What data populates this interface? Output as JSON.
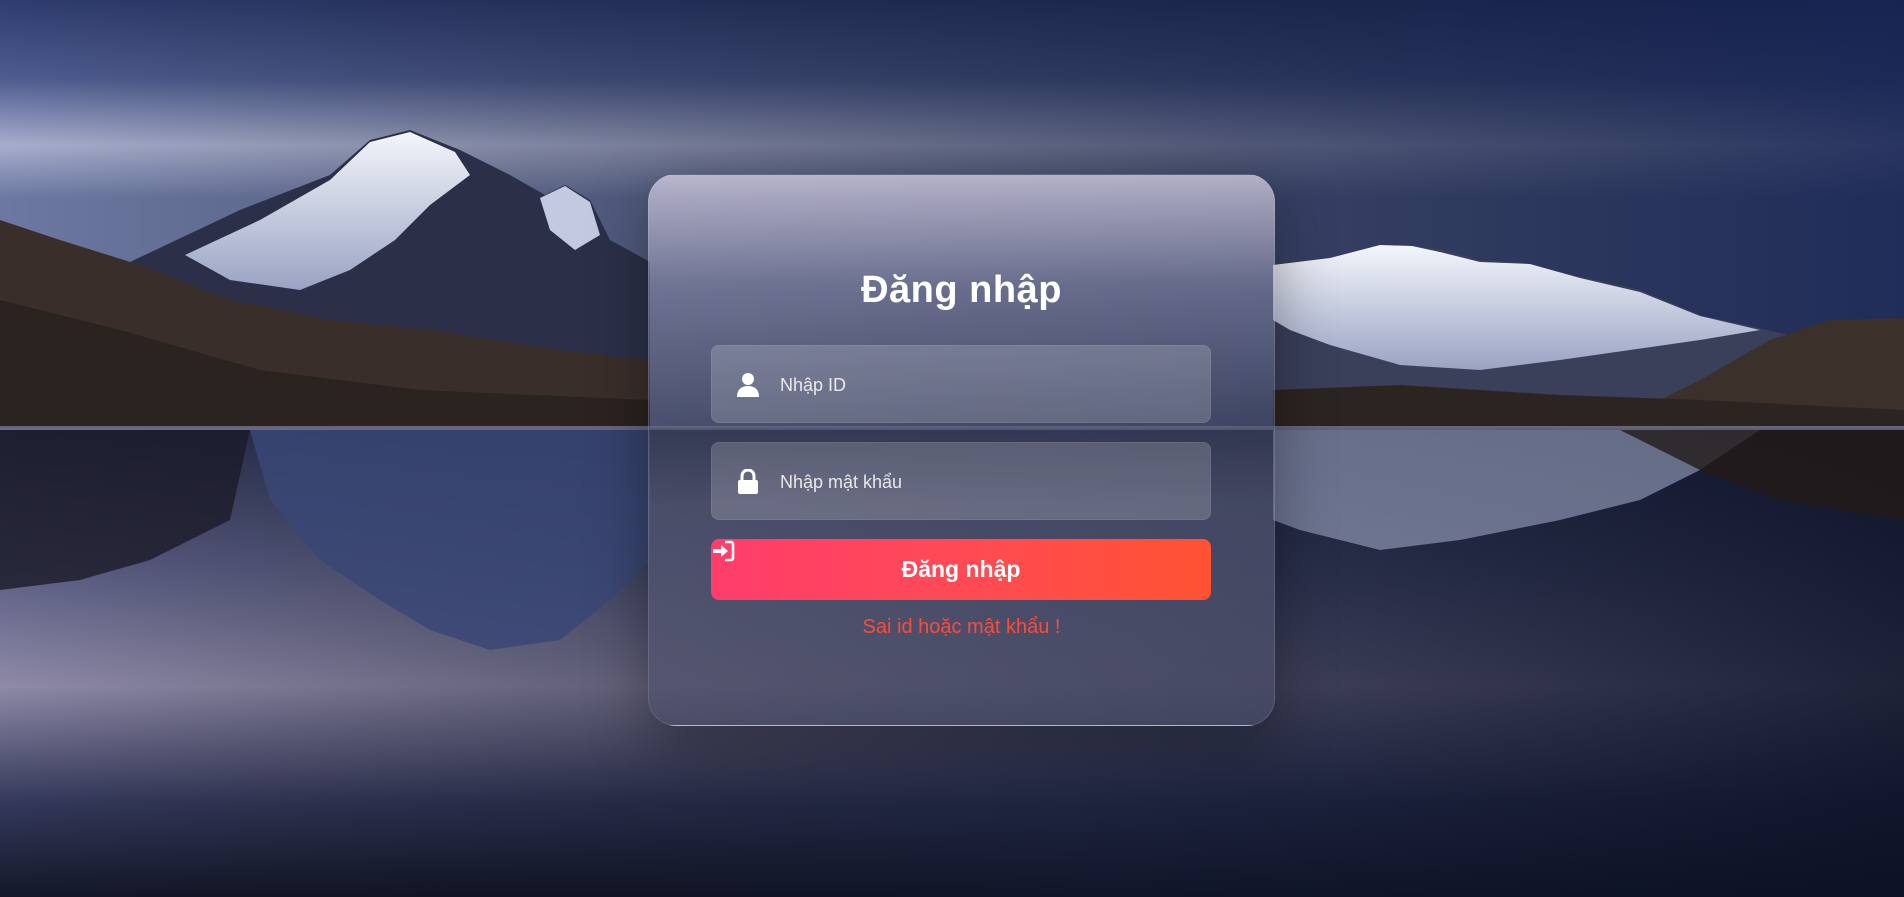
{
  "login_form": {
    "title": "Đăng nhập",
    "id_placeholder": "Nhập ID",
    "password_placeholder": "Nhập mật khẩu",
    "submit_label": "Đăng nhập",
    "error_message": "Sai id hoặc mật khẩu !"
  },
  "icons": {
    "id_field": "user-icon",
    "password_field": "lock-icon",
    "submit": "sign-in-icon"
  },
  "colors": {
    "button_gradient_start": "#ff3d6b",
    "button_gradient_end": "#ff5232",
    "error_text": "#ff4a3a"
  }
}
